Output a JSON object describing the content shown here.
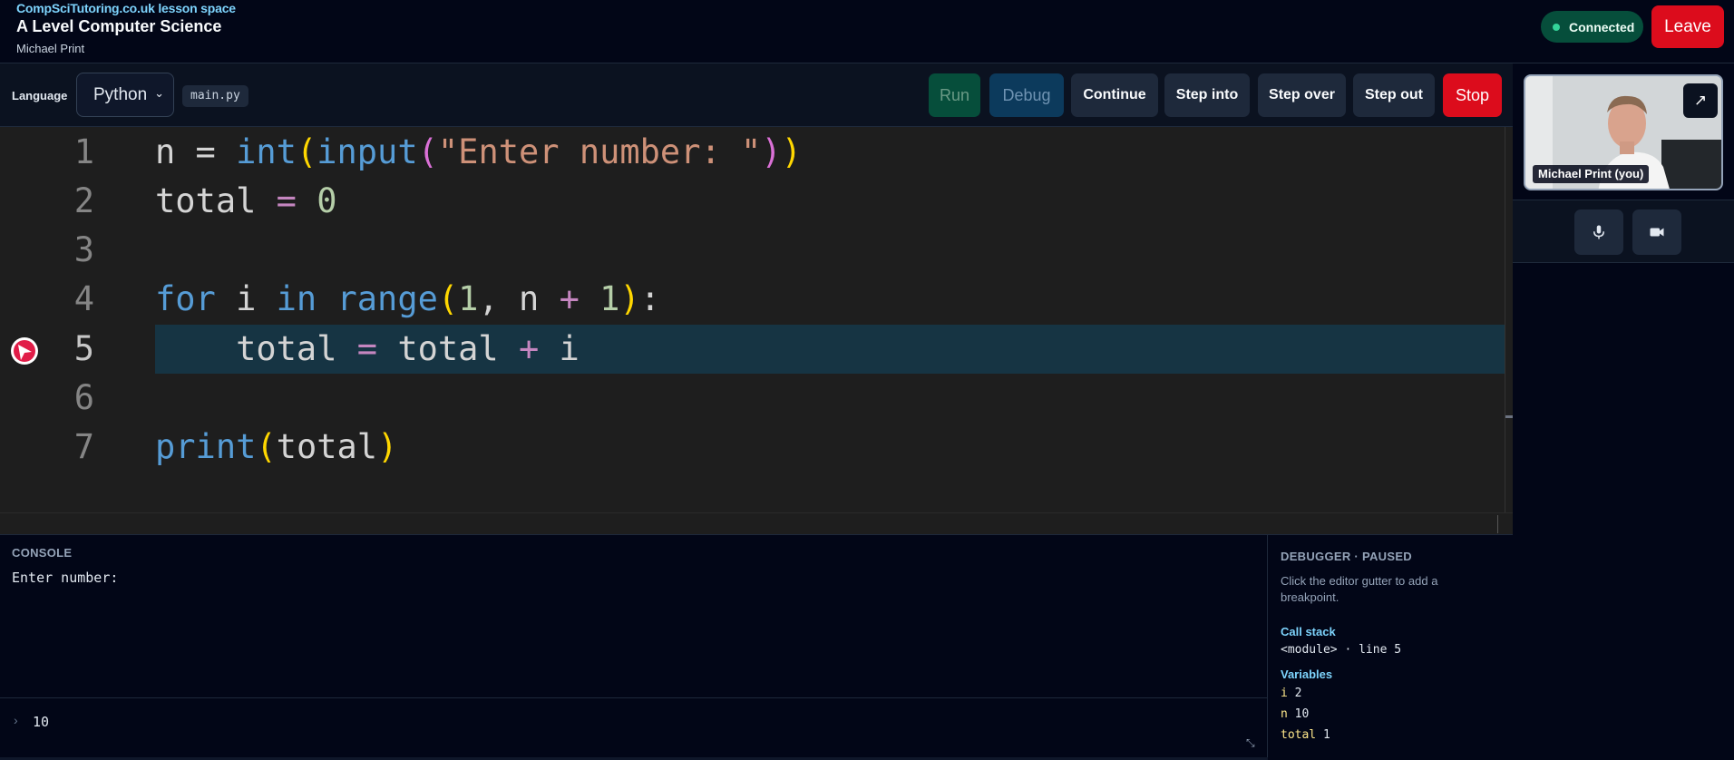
{
  "header": {
    "brand": "CompSciTutoring.co.uk lesson space",
    "course_title": "A Level Computer Science",
    "user_name": "Michael Print",
    "status": "Connected",
    "leave_label": "Leave"
  },
  "toolbar": {
    "language_label": "Language",
    "language_value": "Python",
    "filename": "main.py",
    "run_label": "Run",
    "debug_label": "Debug",
    "continue_label": "Continue",
    "step_into_label": "Step into",
    "step_over_label": "Step over",
    "step_out_label": "Step out",
    "stop_label": "Stop"
  },
  "editor": {
    "line_numbers": [
      "1",
      "2",
      "3",
      "4",
      "5",
      "6",
      "7"
    ],
    "current_line": 5
  },
  "console": {
    "title": "CONSOLE",
    "output": "Enter number:",
    "prompt": "›",
    "input_value": "10"
  },
  "debugger": {
    "title": "DEBUGGER · PAUSED",
    "hint": "Click the editor gutter to add a breakpoint.",
    "call_stack_label": "Call stack",
    "call_stack_frame": "<module> · line 5",
    "variables_label": "Variables",
    "variables": [
      {
        "name": "i",
        "value": "2"
      },
      {
        "name": "n",
        "value": "10"
      },
      {
        "name": "total",
        "value": "1"
      }
    ]
  },
  "video": {
    "participant_label": "Michael Print (you)",
    "expand_icon": "↗"
  },
  "colors": {
    "accent": "#7dd3fc",
    "danger": "#dc0c1c",
    "connected": "#064e3b",
    "current_line": "#163443"
  }
}
